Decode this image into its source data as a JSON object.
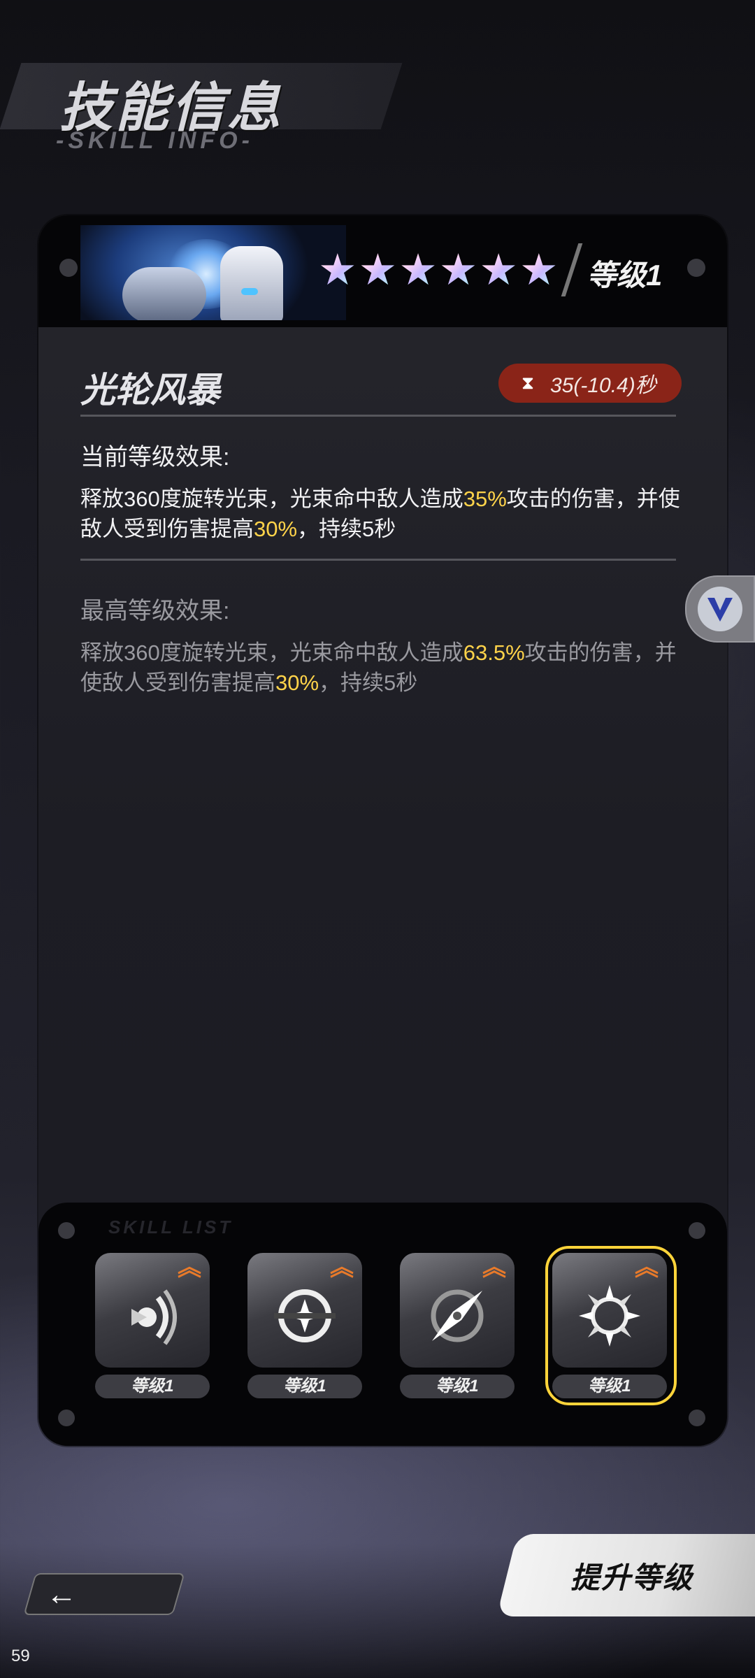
{
  "header": {
    "title": "技能信息",
    "subtitle": "-SKILL INFO-"
  },
  "skill": {
    "stars": [
      "★",
      "★",
      "★",
      "★",
      "★",
      "★"
    ],
    "level_label": "等级1",
    "name": "光轮风暴",
    "cooldown_text": "35(-10.4)秒",
    "current_label": "当前等级效果:",
    "current_desc": {
      "p1": "释放360度旋转光束，光束命中敌人造成",
      "h1": "35%",
      "p2": "攻击的伤害，并使敌人受到伤害提高",
      "h2": "30%",
      "p3": "，持续5秒"
    },
    "max_label": "最高等级效果:",
    "max_desc": {
      "p1": "释放360度旋转光束，光束命中敌人造成",
      "h1": "63.5%",
      "p2": "攻击的伤害，并使敌人受到伤害提高",
      "h2": "30%",
      "p3": "，持续5秒"
    }
  },
  "skill_list": {
    "title": "SKILL LIST",
    "slots": [
      {
        "icon": "sound-wave-icon",
        "level": "等级1",
        "selected": false
      },
      {
        "icon": "ring-star-icon",
        "level": "等级1",
        "selected": false
      },
      {
        "icon": "compass-slash-icon",
        "level": "等级1",
        "selected": false
      },
      {
        "icon": "sun-burst-icon",
        "level": "等级1",
        "selected": true
      }
    ]
  },
  "buttons": {
    "back": "←",
    "upgrade": "提升等级"
  },
  "fps": "59",
  "colors": {
    "highlight": "#ffd34a",
    "cooldown_bg": "#8a2418",
    "selected_border": "#ffd43a"
  }
}
